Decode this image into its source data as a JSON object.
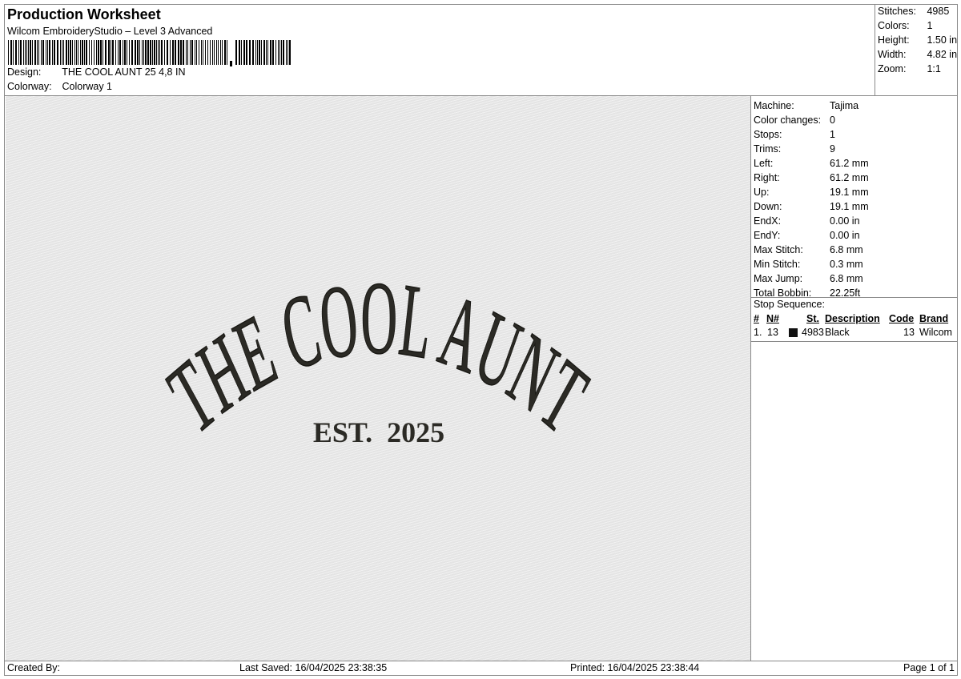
{
  "header": {
    "title": "Production Worksheet",
    "software": "Wilcom EmbroideryStudio – Level 3 Advanced",
    "design_label": "Design:",
    "design_value": "THE COOL AUNT 25 4,8 IN",
    "colorway_label": "Colorway:",
    "colorway_value": "Colorway 1"
  },
  "summary": {
    "stitches_label": "Stitches:",
    "stitches_value": "4985",
    "colors_label": "Colors:",
    "colors_value": "1",
    "height_label": "Height:",
    "height_value": "1.50 in",
    "width_label": "Width:",
    "width_value": "4.82 in",
    "zoom_label": "Zoom:",
    "zoom_value": "1:1"
  },
  "preview": {
    "line1": "THE COOL AUNT",
    "line2": "EST.  2025",
    "thread_color": "#2b2a25",
    "fabric_color": "#e9e9e9"
  },
  "machine_info": [
    {
      "label": "Machine:",
      "value": "Tajima"
    },
    {
      "label": "Color changes:",
      "value": "0"
    },
    {
      "label": "Stops:",
      "value": "1"
    },
    {
      "label": "Trims:",
      "value": "9"
    },
    {
      "label": "Left:",
      "value": "61.2 mm"
    },
    {
      "label": "Right:",
      "value": "61.2 mm"
    },
    {
      "label": "Up:",
      "value": "19.1 mm"
    },
    {
      "label": "Down:",
      "value": "19.1 mm"
    },
    {
      "label": "EndX:",
      "value": "0.00 in"
    },
    {
      "label": "EndY:",
      "value": "0.00 in"
    },
    {
      "label": "Max Stitch:",
      "value": "6.8 mm"
    },
    {
      "label": "Min Stitch:",
      "value": "0.3 mm"
    },
    {
      "label": "Max Jump:",
      "value": "6.8 mm"
    },
    {
      "label": "Total Bobbin:",
      "value": "22.25ft"
    }
  ],
  "stop_sequence": {
    "title": "Stop Sequence:",
    "headers": {
      "num": "#",
      "n": "N#",
      "st": "St.",
      "description": "Description",
      "code": "Code",
      "brand": "Brand"
    },
    "rows": [
      {
        "num": "1.",
        "n": "13",
        "st": "4983",
        "description": "Black",
        "code": "13",
        "brand": "Wilcom",
        "swatch": "#111111"
      }
    ]
  },
  "footer": {
    "created_by": "Created By:",
    "last_saved": "Last Saved: 16/04/2025 23:38:35",
    "printed": "Printed: 16/04/2025 23:38:44",
    "page": "Page 1 of 1"
  }
}
